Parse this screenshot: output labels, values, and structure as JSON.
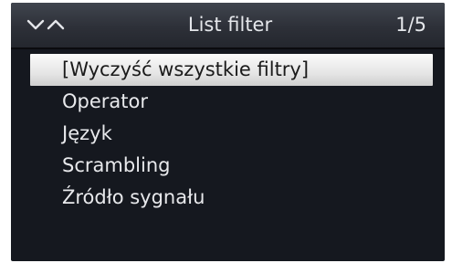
{
  "header": {
    "title": "List filter",
    "page_indicator": "1/5",
    "nav_icon": "up-down-chevrons-icon"
  },
  "menu": {
    "items": [
      {
        "label": "[Wyczyść wszystkie filtry]",
        "selected": true
      },
      {
        "label": "Operator",
        "selected": false
      },
      {
        "label": "Język",
        "selected": false
      },
      {
        "label": "Scrambling",
        "selected": false
      },
      {
        "label": "Źródło sygnału",
        "selected": false
      }
    ]
  },
  "colors": {
    "header_bg": "#2d3038",
    "panel_bg": "#15181f",
    "highlight_bg": "#e6e6e6",
    "text": "#e8e9ec"
  }
}
